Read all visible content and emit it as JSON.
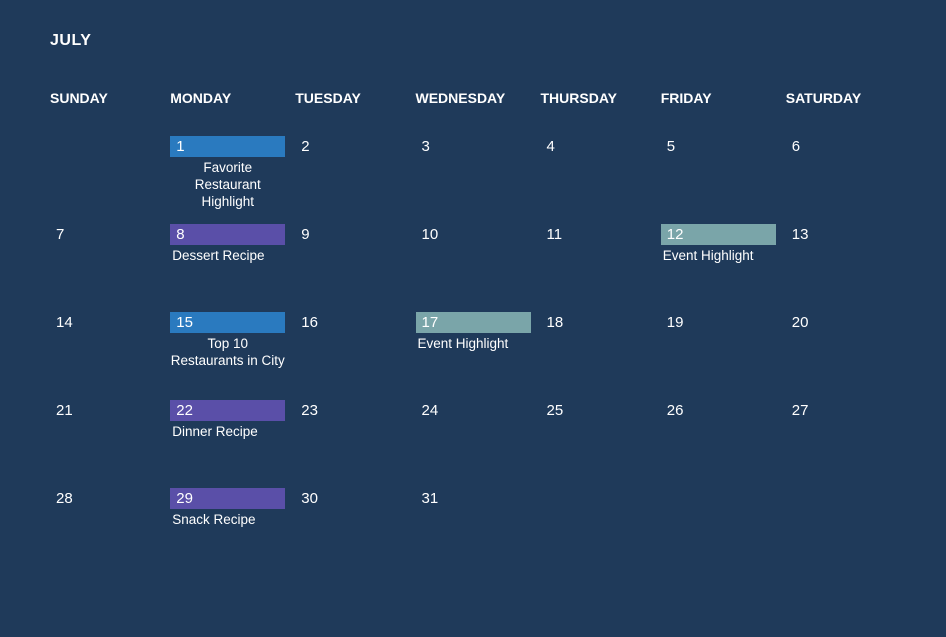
{
  "month_title": "JULY",
  "days_of_week": [
    "SUNDAY",
    "MONDAY",
    "TUESDAY",
    "WEDNESDAY",
    "THURSDAY",
    "FRIDAY",
    "SATURDAY"
  ],
  "cells": [
    {
      "day": "",
      "event": "",
      "chip": ""
    },
    {
      "day": "1",
      "event": "Favorite Restaurant Highlight",
      "chip": "blue",
      "align": "center"
    },
    {
      "day": "2",
      "event": "",
      "chip": ""
    },
    {
      "day": "3",
      "event": "",
      "chip": ""
    },
    {
      "day": "4",
      "event": "",
      "chip": ""
    },
    {
      "day": "5",
      "event": "",
      "chip": ""
    },
    {
      "day": "6",
      "event": "",
      "chip": ""
    },
    {
      "day": "7",
      "event": "",
      "chip": ""
    },
    {
      "day": "8",
      "event": "Dessert Recipe",
      "chip": "purple",
      "align": "left"
    },
    {
      "day": "9",
      "event": "",
      "chip": ""
    },
    {
      "day": "10",
      "event": "",
      "chip": ""
    },
    {
      "day": "11",
      "event": "",
      "chip": ""
    },
    {
      "day": "12",
      "event": "Event Highlight",
      "chip": "teal",
      "align": "left"
    },
    {
      "day": "13",
      "event": "",
      "chip": ""
    },
    {
      "day": "14",
      "event": "",
      "chip": ""
    },
    {
      "day": "15",
      "event": "Top 10 Restaurants in City",
      "chip": "blue",
      "align": "center"
    },
    {
      "day": "16",
      "event": "",
      "chip": ""
    },
    {
      "day": "17",
      "event": "Event Highlight",
      "chip": "teal",
      "align": "left"
    },
    {
      "day": "18",
      "event": "",
      "chip": ""
    },
    {
      "day": "19",
      "event": "",
      "chip": ""
    },
    {
      "day": "20",
      "event": "",
      "chip": ""
    },
    {
      "day": "21",
      "event": "",
      "chip": ""
    },
    {
      "day": "22",
      "event": "Dinner Recipe",
      "chip": "purple",
      "align": "left"
    },
    {
      "day": "23",
      "event": "",
      "chip": ""
    },
    {
      "day": "24",
      "event": "",
      "chip": ""
    },
    {
      "day": "25",
      "event": "",
      "chip": ""
    },
    {
      "day": "26",
      "event": "",
      "chip": ""
    },
    {
      "day": "27",
      "event": "",
      "chip": ""
    },
    {
      "day": "28",
      "event": "",
      "chip": ""
    },
    {
      "day": "29",
      "event": "Snack Recipe",
      "chip": "purple",
      "align": "left"
    },
    {
      "day": "30",
      "event": "",
      "chip": ""
    },
    {
      "day": "31",
      "event": "",
      "chip": ""
    },
    {
      "day": "",
      "event": "",
      "chip": ""
    },
    {
      "day": "",
      "event": "",
      "chip": ""
    },
    {
      "day": "",
      "event": "",
      "chip": ""
    }
  ],
  "colors": {
    "blue": "#2a7abf",
    "purple": "#5a4fa8",
    "teal": "#7aa5a9"
  }
}
